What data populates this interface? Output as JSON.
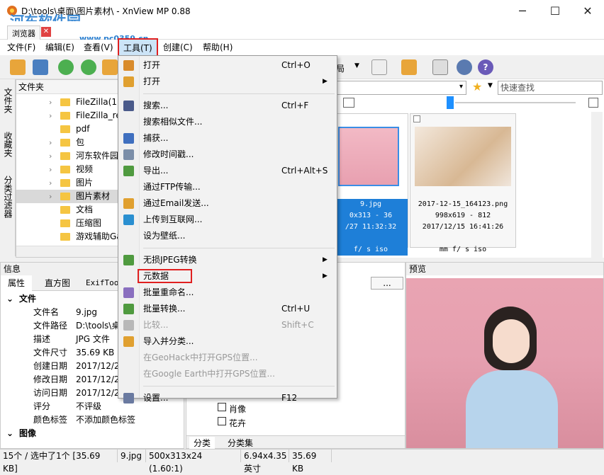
{
  "window": {
    "title": "D:\\tools\\桌面\\图片素材\\ - XnView MP 0.88",
    "minimize": "─",
    "maximize": "☐",
    "close": "✕",
    "watermark": "河东软件园",
    "watermark_url": "www.pc0359.cn"
  },
  "tabs": {
    "browser": "浏览器"
  },
  "menubar": {
    "file": "文件(F)",
    "edit": "编辑(E)",
    "view": "查看(V)",
    "tools": "工具(T)",
    "create": "创建(C)",
    "help": "帮助(H)"
  },
  "toolbar": {
    "layout_label": "局"
  },
  "side_tabs": [
    "文件夹",
    "收藏夹",
    "分类过滤器"
  ],
  "folder_panel": {
    "header": "文件夹",
    "items": [
      "FileZilla(1)",
      "FileZilla_re",
      "pdf",
      "包",
      "河东软件园",
      "视频",
      "图片",
      "图片素材",
      "文档",
      "压缩图",
      "游戏辅助Ga"
    ]
  },
  "search": {
    "placeholder": "快速查找"
  },
  "thumbnails": [
    {
      "name": "9.jpg",
      "size": "0x313 - 36",
      "date": "/27 11:32:32",
      "exif": "f/ s iso"
    },
    {
      "name": "2017-12-15_164123.png",
      "size": "998x619 - 812",
      "date": "2017/12/15 16:41:26",
      "exif": "mm f/ s iso"
    }
  ],
  "info_panel": {
    "title": "信息",
    "tabs": [
      "属性",
      "直方图",
      "ExifTool"
    ],
    "section_file": "文件",
    "section_image": "图像",
    "rows": [
      {
        "key": "文件名",
        "value": "9.jpg"
      },
      {
        "key": "文件路径",
        "value": "D:\\tools\\桌"
      },
      {
        "key": "描述",
        "value": "JPG 文件"
      },
      {
        "key": "文件尺寸",
        "value": "35.69 KB ("
      },
      {
        "key": "创建日期",
        "value": "2017/12/2"
      },
      {
        "key": "修改日期",
        "value": "2017/12/2"
      },
      {
        "key": "访问日期",
        "value": "2017/12/2"
      },
      {
        "key": "评分",
        "value": "不评级"
      },
      {
        "key": "颜色标签",
        "value": "不添加颜色标签"
      }
    ]
  },
  "category_panel": {
    "dropdown": "...",
    "items": [
      "肖像",
      "花卉"
    ],
    "tabs": [
      "分类",
      "分类集"
    ]
  },
  "preview_panel": {
    "title": "预览"
  },
  "statusbar": {
    "count": "15个 / 选中了1个 [35.69 KB]",
    "filename": "9.jpg",
    "dims": "500x313x24 (1.60:1)",
    "inches": "6.94x4.35 英寸",
    "size": "35.69 KB"
  },
  "tools_menu": {
    "items": [
      {
        "label": "打开",
        "key": "Ctrl+O",
        "icon": "open-icon",
        "color": "#d98b2b"
      },
      {
        "label": "打开",
        "key": "",
        "icon": "open-with-icon",
        "color": "#e0a030",
        "submenu": true
      },
      {
        "separator": true
      },
      {
        "label": "搜索...",
        "key": "Ctrl+F",
        "icon": "binoculars-icon",
        "color": "#4a5a8a"
      },
      {
        "label": "搜索相似文件...",
        "key": "",
        "icon": "",
        "color": ""
      },
      {
        "label": "捕获...",
        "key": "",
        "icon": "capture-icon",
        "color": "#3f6fbf"
      },
      {
        "label": "修改时间戳...",
        "key": "",
        "icon": "timestamp-icon",
        "color": "#7b8ea8"
      },
      {
        "label": "导出...",
        "key": "Ctrl+Alt+S",
        "icon": "export-icon",
        "color": "#4f9a3f"
      },
      {
        "label": "通过FTP传输...",
        "key": "",
        "icon": "",
        "color": ""
      },
      {
        "label": "通过Email发送...",
        "key": "",
        "icon": "email-icon",
        "color": "#e0a030"
      },
      {
        "label": "上传到互联网...",
        "key": "",
        "icon": "globe-icon",
        "color": "#2a8fd0"
      },
      {
        "label": "设为壁纸...",
        "key": "",
        "icon": "",
        "color": ""
      },
      {
        "separator": true
      },
      {
        "label": "无损JPEG转换",
        "key": "",
        "icon": "jpeg-transform-icon",
        "color": "#4f9a3f",
        "submenu": true
      },
      {
        "label": "元数据",
        "key": "",
        "icon": "",
        "color": "",
        "submenu": true,
        "highlight": true
      },
      {
        "label": "批量重命名...",
        "key": "",
        "icon": "rename-icon",
        "color": "#8a6fbf"
      },
      {
        "label": "批量转换...",
        "key": "Ctrl+U",
        "icon": "batch-convert-icon",
        "color": "#4f9a3f"
      },
      {
        "label": "比较...",
        "key": "Shift+C",
        "icon": "compare-icon",
        "color": "#b8b8b8",
        "disabled": true
      },
      {
        "label": "导入并分类...",
        "key": "",
        "icon": "import-icon",
        "color": "#e0a030"
      },
      {
        "label": "在GeoHack中打开GPS位置...",
        "key": "",
        "icon": "",
        "color": "",
        "disabled": true
      },
      {
        "label": "在Google Earth中打开GPS位置...",
        "key": "",
        "icon": "",
        "color": "",
        "disabled": true
      },
      {
        "separator": true
      },
      {
        "label": "设置...",
        "key": "F12",
        "icon": "gear-icon",
        "color": "#6a7aa0"
      }
    ]
  },
  "colors": {
    "accent": "#0078d7",
    "highlight_box": "#e02020",
    "selection": "#cce4f7"
  }
}
